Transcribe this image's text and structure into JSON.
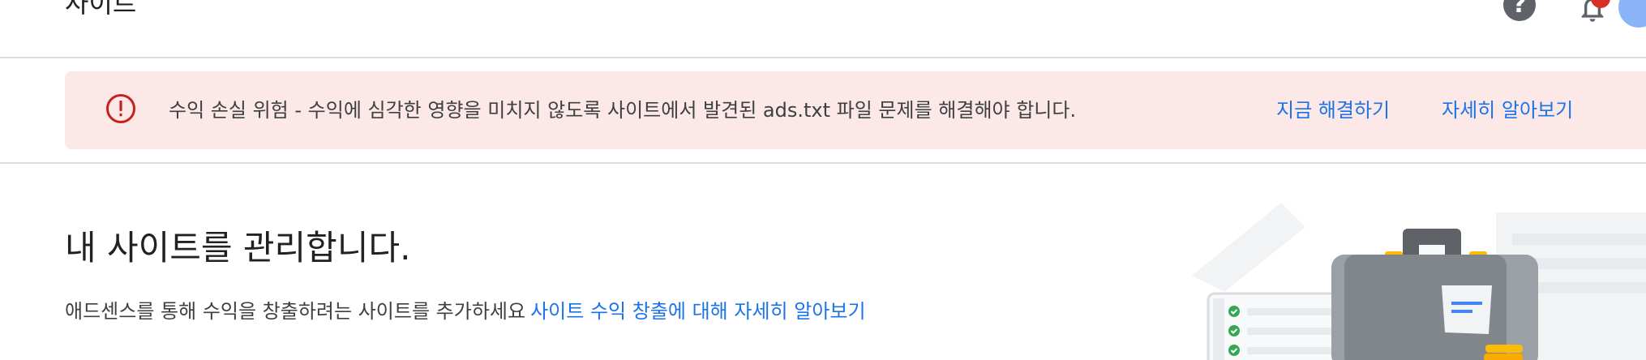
{
  "header": {
    "title": "사이트",
    "help_icon": "help-circle-icon",
    "help_glyph": "?",
    "notifications_icon": "bell-icon",
    "account_icon": "avatar"
  },
  "alert": {
    "icon": "error-circle-icon",
    "message": "수익 손실 위험 - 수익에 심각한 영향을 미치지 않도록 사이트에서 발견된 ads.txt 파일 문제를 해결해야 합니다.",
    "fix_now": "지금 해결하기",
    "learn_more": "자세히 알아보기",
    "colors": {
      "background": "#fce8e6",
      "icon": "#c5221f",
      "link": "#1a73e8"
    }
  },
  "main": {
    "heading": "내 사이트를 관리합니다.",
    "description": "애드센스를 통해 수익을 창출하려는 사이트를 추가하세요",
    "description_link": "사이트 수익 창출에 대해 자세히 알아보기",
    "illustration": "briefcase-checklist-illustration"
  }
}
